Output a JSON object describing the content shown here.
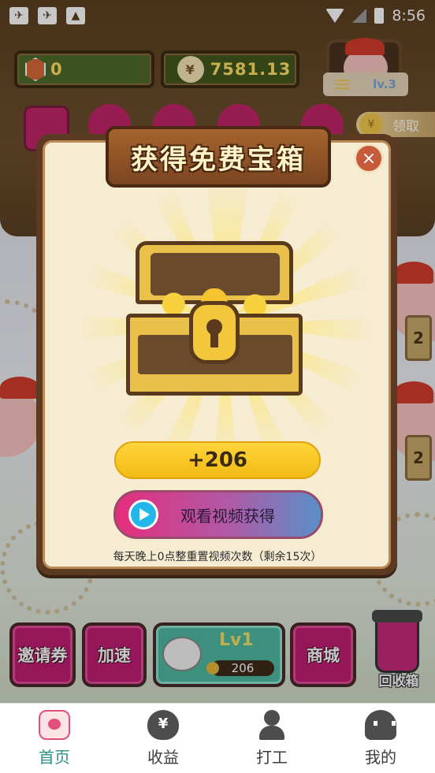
{
  "status_bar": {
    "time": "8:56",
    "left_icons": [
      "bird-notification-icon",
      "bird-notification-icon",
      "bag-notification-icon"
    ],
    "right_icons": [
      "wifi-icon",
      "no-signal-icon",
      "battery-charging-icon"
    ]
  },
  "resources": {
    "gems": "0",
    "coins": "7581.13"
  },
  "profile": {
    "level_label": "lv.3"
  },
  "claim": {
    "label": "领取"
  },
  "side_tags": [
    "2",
    "2"
  ],
  "dialog": {
    "title": "获得免费宝箱",
    "close_symbol": "×",
    "reward_amount": "+206",
    "watch_video_label": "观看视频获得",
    "reset_note": "每天晚上0点整重置视频次数（剩余15次）"
  },
  "game_buttons": {
    "invite": "邀请券",
    "speed_up": "加速",
    "shop": "商城",
    "recycle": "回收箱"
  },
  "level_panel": {
    "level": "Lv1",
    "coins": "206"
  },
  "nav": {
    "items": [
      {
        "label": "首页",
        "icon": "home-pig-icon",
        "active": true
      },
      {
        "label": "收益",
        "icon": "money-bag-icon",
        "active": false
      },
      {
        "label": "打工",
        "icon": "worker-icon",
        "active": false
      },
      {
        "label": "我的",
        "icon": "profile-icon",
        "active": false
      }
    ]
  },
  "colors": {
    "accent": "#2c8f86",
    "button_pink": "#c01e72",
    "reward_yellow": "#ffd43a"
  }
}
